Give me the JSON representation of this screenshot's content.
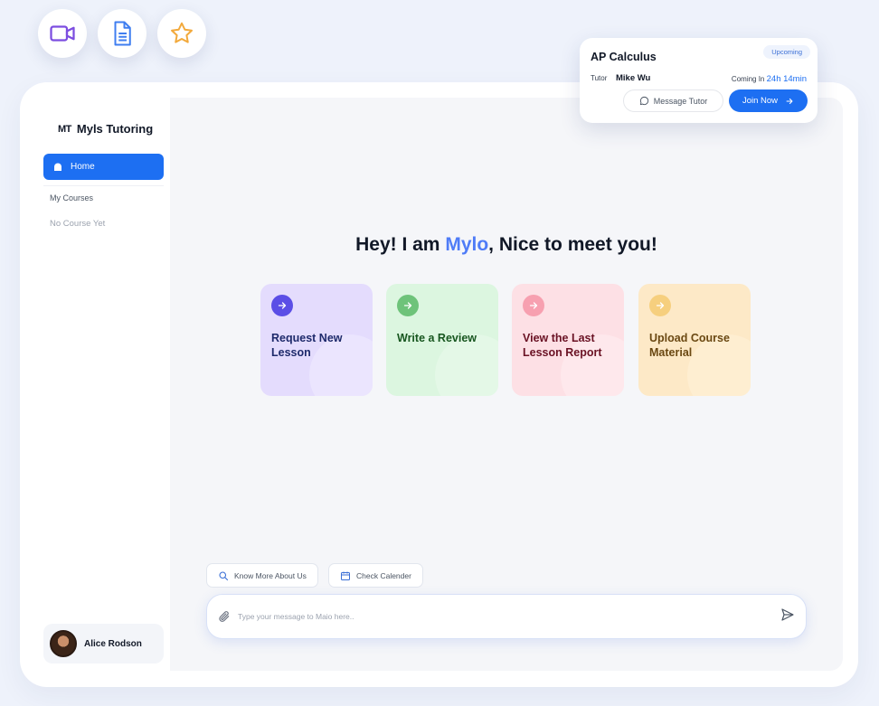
{
  "brand": {
    "mark": "MT",
    "name": "Myls Tutoring"
  },
  "sidebar": {
    "home_label": "Home",
    "section_label": "My Courses",
    "empty_label": "No Course Yet"
  },
  "user": {
    "name": "Alice Rodson"
  },
  "main": {
    "headline_pre": "Hey! I am ",
    "headline_accent": "Mylo",
    "headline_post": ", Nice to meet you!",
    "cards": [
      {
        "label": "Request New Lesson"
      },
      {
        "label": "Write a Review"
      },
      {
        "label": "View the Last Lesson Report"
      },
      {
        "label": "Upload Course Material"
      }
    ],
    "chips": [
      {
        "label": "Know More About Us"
      },
      {
        "label": "Check Calender"
      }
    ],
    "chat": {
      "placeholder": "Type your message to Maio here.."
    }
  },
  "session": {
    "title": "AP Calculus",
    "badge": "Upcoming",
    "tutor_label": "Tutor",
    "tutor_name": "Mike Wu",
    "coming_label": "Coming In",
    "coming_time": "24h 14min",
    "message_label": "Message Tutor",
    "join_label": "Join Now"
  },
  "colors": {
    "primary": "#1d6ff2",
    "accent": "#4f7cf7",
    "card_purple": "#e4dcfd",
    "card_green": "#dcf6e0",
    "card_pink": "#fde0e5",
    "card_orange": "#fde9c7"
  },
  "icons": {
    "floating": [
      "video-icon",
      "document-icon",
      "star-icon"
    ]
  }
}
